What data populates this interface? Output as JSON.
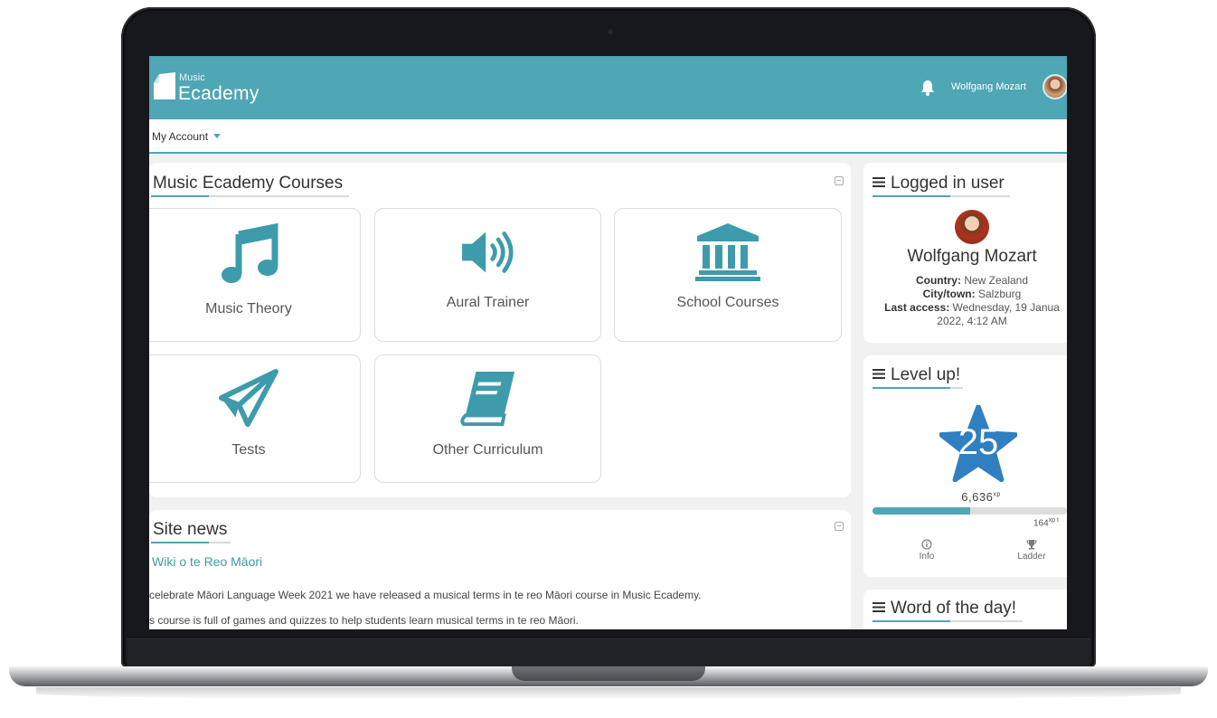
{
  "header": {
    "logo_small": "Music",
    "logo_big": "Ecademy",
    "user_name": "Wolfgang Mozart"
  },
  "nav": {
    "my_account": "My Account"
  },
  "courses": {
    "title": "Music Ecademy Courses",
    "items": [
      {
        "label": "Music Theory",
        "icon": "music-note-icon"
      },
      {
        "label": "Aural Trainer",
        "icon": "speaker-icon"
      },
      {
        "label": "School Courses",
        "icon": "building-icon"
      },
      {
        "label": "Tests",
        "icon": "paper-plane-icon"
      },
      {
        "label": "Other Curriculum",
        "icon": "book-icon"
      }
    ]
  },
  "news": {
    "title": "Site news",
    "link": "Wiki o te Reo Māori",
    "line1": "celebrate Māori Language Week 2021 we have released a musical terms in te reo Māori course in Music Ecademy.",
    "line2": "s course is full of games and quizzes to help students learn musical terms in te reo Māori."
  },
  "logged_in": {
    "title": "Logged in user",
    "name": "Wolfgang Mozart",
    "country_label": "Country:",
    "country": "New Zealand",
    "city_label": "City/town:",
    "city": "Salzburg",
    "access_label": "Last access:",
    "access_line1": "Wednesday, 19 Janua",
    "access_line2": "2022, 4:12 AM"
  },
  "level": {
    "title": "Level up!",
    "level": "25",
    "xp": "6,636",
    "xp_unit": "xp",
    "xp_to_next": "164",
    "xp_to_next_suffix": "xp t",
    "progress_fraction": 0.5,
    "info_label": "Info",
    "ladder_label": "Ladder"
  },
  "word": {
    "title": "Word of the day!"
  },
  "colors": {
    "brand": "#4fa6b4",
    "star": "#2f7fc1"
  }
}
